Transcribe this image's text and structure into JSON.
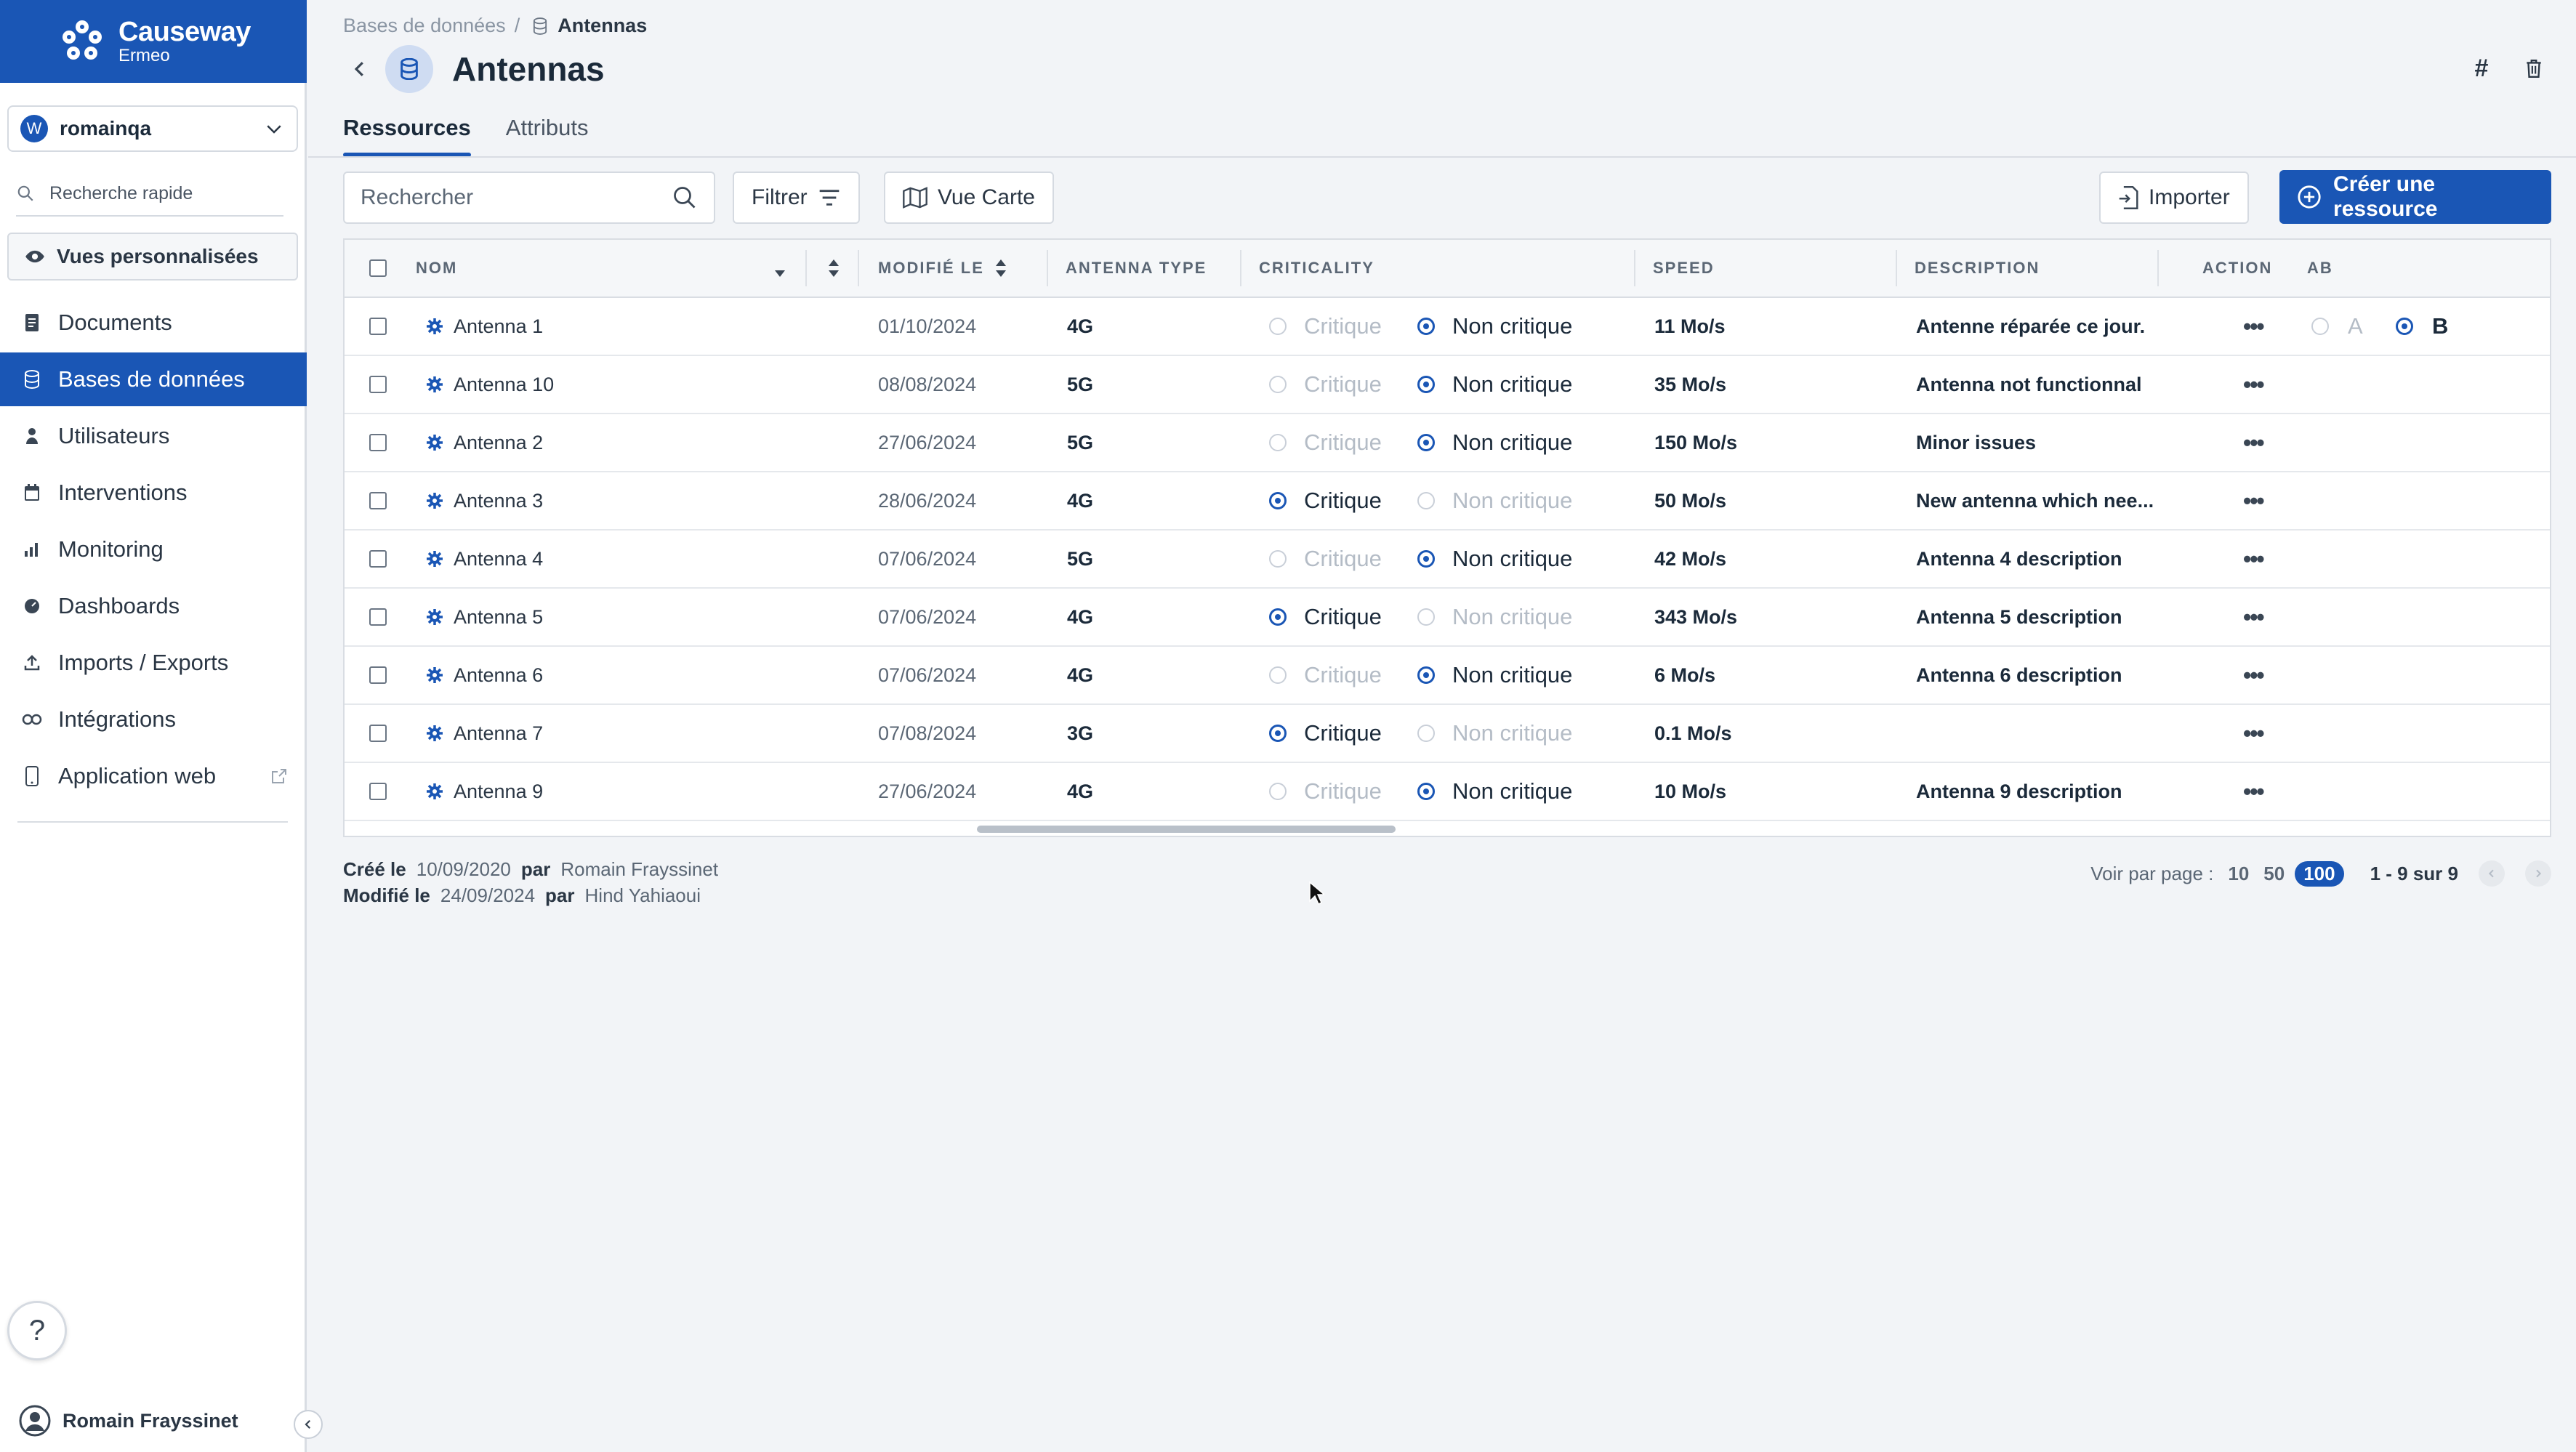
{
  "brand": {
    "name": "Causeway",
    "sub": "Ermeo"
  },
  "workspace": {
    "initial": "W",
    "name": "romainqa"
  },
  "quick_search": {
    "label": "Recherche rapide"
  },
  "custom_views": {
    "label": "Vues personnalisées"
  },
  "nav": [
    {
      "label": "Documents",
      "icon": "document-icon"
    },
    {
      "label": "Bases de données",
      "icon": "database-icon",
      "active": true
    },
    {
      "label": "Utilisateurs",
      "icon": "user-icon"
    },
    {
      "label": "Interventions",
      "icon": "calendar-icon"
    },
    {
      "label": "Monitoring",
      "icon": "bar-chart-icon"
    },
    {
      "label": "Dashboards",
      "icon": "dashboard-icon"
    },
    {
      "label": "Imports / Exports",
      "icon": "upload-icon"
    },
    {
      "label": "Intégrations",
      "icon": "integration-icon"
    },
    {
      "label": "Application web",
      "icon": "mobile-icon"
    }
  ],
  "help": {
    "label": "?"
  },
  "user": {
    "name": "Romain Frayssinet"
  },
  "breadcrumb": {
    "parent": "Bases de données",
    "sep": "/",
    "current": "Antennas"
  },
  "page": {
    "title": "Antennas",
    "hash_label": "#"
  },
  "tabs": [
    {
      "label": "Ressources",
      "active": true
    },
    {
      "label": "Attributs",
      "active": false
    }
  ],
  "toolbar": {
    "search_placeholder": "Rechercher",
    "filter_label": "Filtrer",
    "map_label": "Vue Carte",
    "import_label": "Importer",
    "create_label": "Créer une ressource"
  },
  "table": {
    "headers": {
      "name": "NOM",
      "modified": "MODIFIÉ LE",
      "type": "ANTENNA TYPE",
      "criticality": "CRITICALITY",
      "speed": "SPEED",
      "description": "DESCRIPTION",
      "action": "ACTION",
      "ab": "AB"
    },
    "crit_options": {
      "critical": "Critique",
      "non_critical": "Non critique"
    },
    "ab_options": {
      "a": "A",
      "b": "B"
    },
    "action_label": "•••",
    "rows": [
      {
        "name": "Antenna 1",
        "modified": "01/10/2024",
        "type": "4G",
        "critical": false,
        "speed": "11 Mo/s",
        "description": "Antenne réparée ce jour.",
        "ab": "B"
      },
      {
        "name": "Antenna 10",
        "modified": "08/08/2024",
        "type": "5G",
        "critical": false,
        "speed": "35 Mo/s",
        "description": "Antenna not functionnal"
      },
      {
        "name": "Antenna 2",
        "modified": "27/06/2024",
        "type": "5G",
        "critical": false,
        "speed": "150 Mo/s",
        "description": "Minor issues"
      },
      {
        "name": "Antenna 3",
        "modified": "28/06/2024",
        "type": "4G",
        "critical": true,
        "speed": "50 Mo/s",
        "description": "New antenna which nee..."
      },
      {
        "name": "Antenna 4",
        "modified": "07/06/2024",
        "type": "5G",
        "critical": false,
        "speed": "42 Mo/s",
        "description": "Antenna 4 description"
      },
      {
        "name": "Antenna 5",
        "modified": "07/06/2024",
        "type": "4G",
        "critical": true,
        "speed": "343 Mo/s",
        "description": "Antenna 5 description"
      },
      {
        "name": "Antenna 6",
        "modified": "07/06/2024",
        "type": "4G",
        "critical": false,
        "speed": "6 Mo/s",
        "description": "Antenna 6 description"
      },
      {
        "name": "Antenna 7",
        "modified": "07/08/2024",
        "type": "3G",
        "critical": true,
        "speed": "0.1 Mo/s",
        "description": ""
      },
      {
        "name": "Antenna 9",
        "modified": "27/06/2024",
        "type": "4G",
        "critical": false,
        "speed": "10 Mo/s",
        "description": "Antenna 9 description"
      }
    ]
  },
  "meta": {
    "created_label": "Créé le",
    "created_date": "10/09/2020",
    "by": "par",
    "created_by": "Romain Frayssinet",
    "modified_label": "Modifié le",
    "modified_date": "24/09/2024",
    "modified_by": "Hind Yahiaoui"
  },
  "pagination": {
    "per_page_label": "Voir par page :",
    "options": [
      "10",
      "50",
      "100"
    ],
    "selected": "100",
    "range": "1 - 9 sur 9"
  },
  "colors": {
    "accent": "#1a56b5",
    "sidebar_bg": "#ffffff",
    "page_bg": "#f2f4f7"
  }
}
